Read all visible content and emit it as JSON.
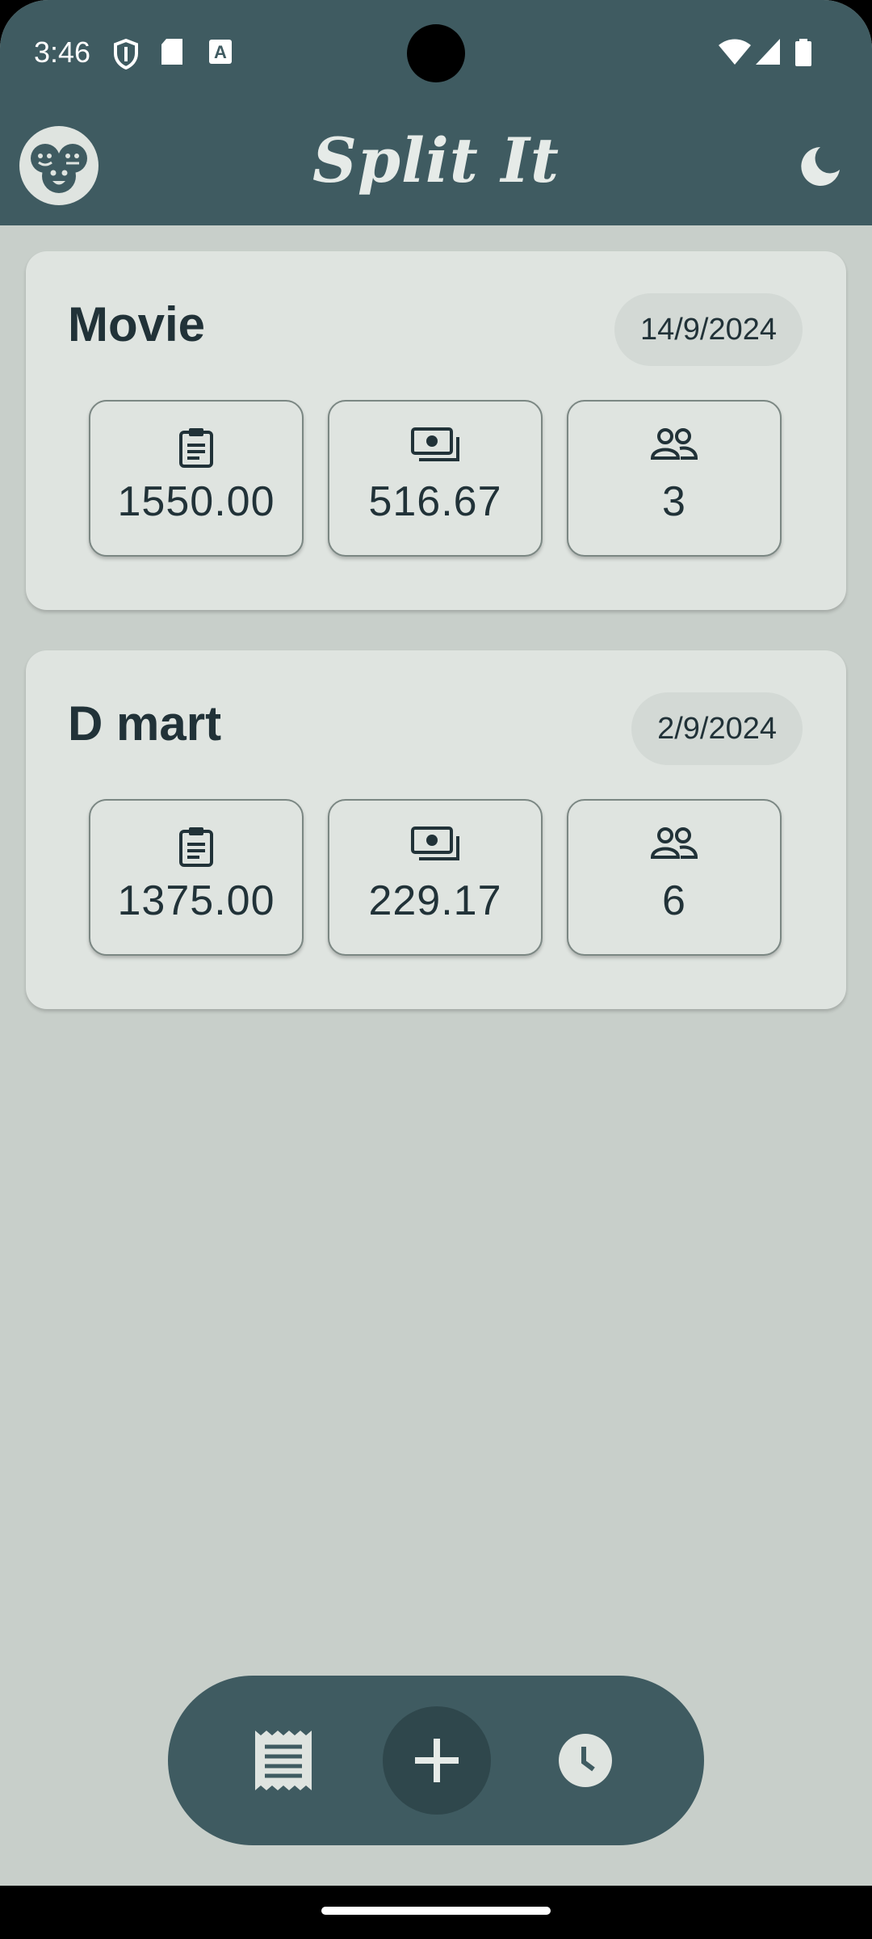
{
  "status_bar": {
    "time": "3:46"
  },
  "app_bar": {
    "title": "Split It"
  },
  "colors": {
    "primary": "#3f5b61",
    "background": "#c8cfca",
    "card": "#dfe4e0",
    "text": "#213238"
  },
  "cards": [
    {
      "title": "Movie",
      "date": "14/9/2024",
      "total": "1550.00",
      "per_person": "516.67",
      "people": "3"
    },
    {
      "title": "D mart",
      "date": "2/9/2024",
      "total": "1375.00",
      "per_person": "229.17",
      "people": "6"
    }
  ],
  "icons": {
    "total": "clipboard-icon",
    "per_person": "money-icon",
    "people": "group-icon",
    "nav_bills": "receipt-icon",
    "nav_add": "plus-icon",
    "nav_history": "clock-icon",
    "theme": "moon-icon"
  }
}
